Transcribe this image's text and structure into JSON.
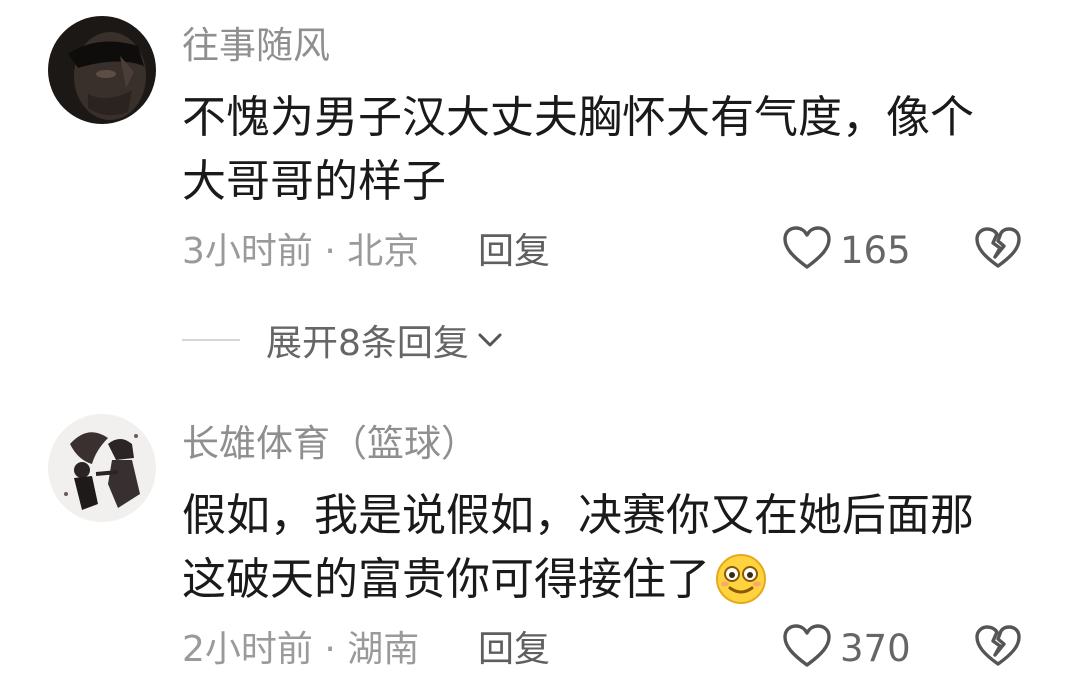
{
  "comments": [
    {
      "username": "往事随风",
      "lines": [
        "不愧为男子汉大丈夫胸怀大有气度，像个",
        "大哥哥的样子"
      ],
      "time_location": "3小时前 · 北京",
      "reply_label": "回复",
      "likes": "165",
      "expand_label": "展开8条回复"
    },
    {
      "username": "长雄体育（篮球）",
      "lines": [
        "假如，我是说假如，决赛你又在她后面那",
        "这破天的富贵你可得接住了"
      ],
      "time_location": "2小时前 · 湖南",
      "reply_label": "回复",
      "likes": "370"
    }
  ],
  "icons": {
    "like": "heart-outline-icon",
    "dislike": "broken-heart-icon",
    "expand": "chevron-down-icon",
    "emoji": "smiling-face-emoji"
  }
}
